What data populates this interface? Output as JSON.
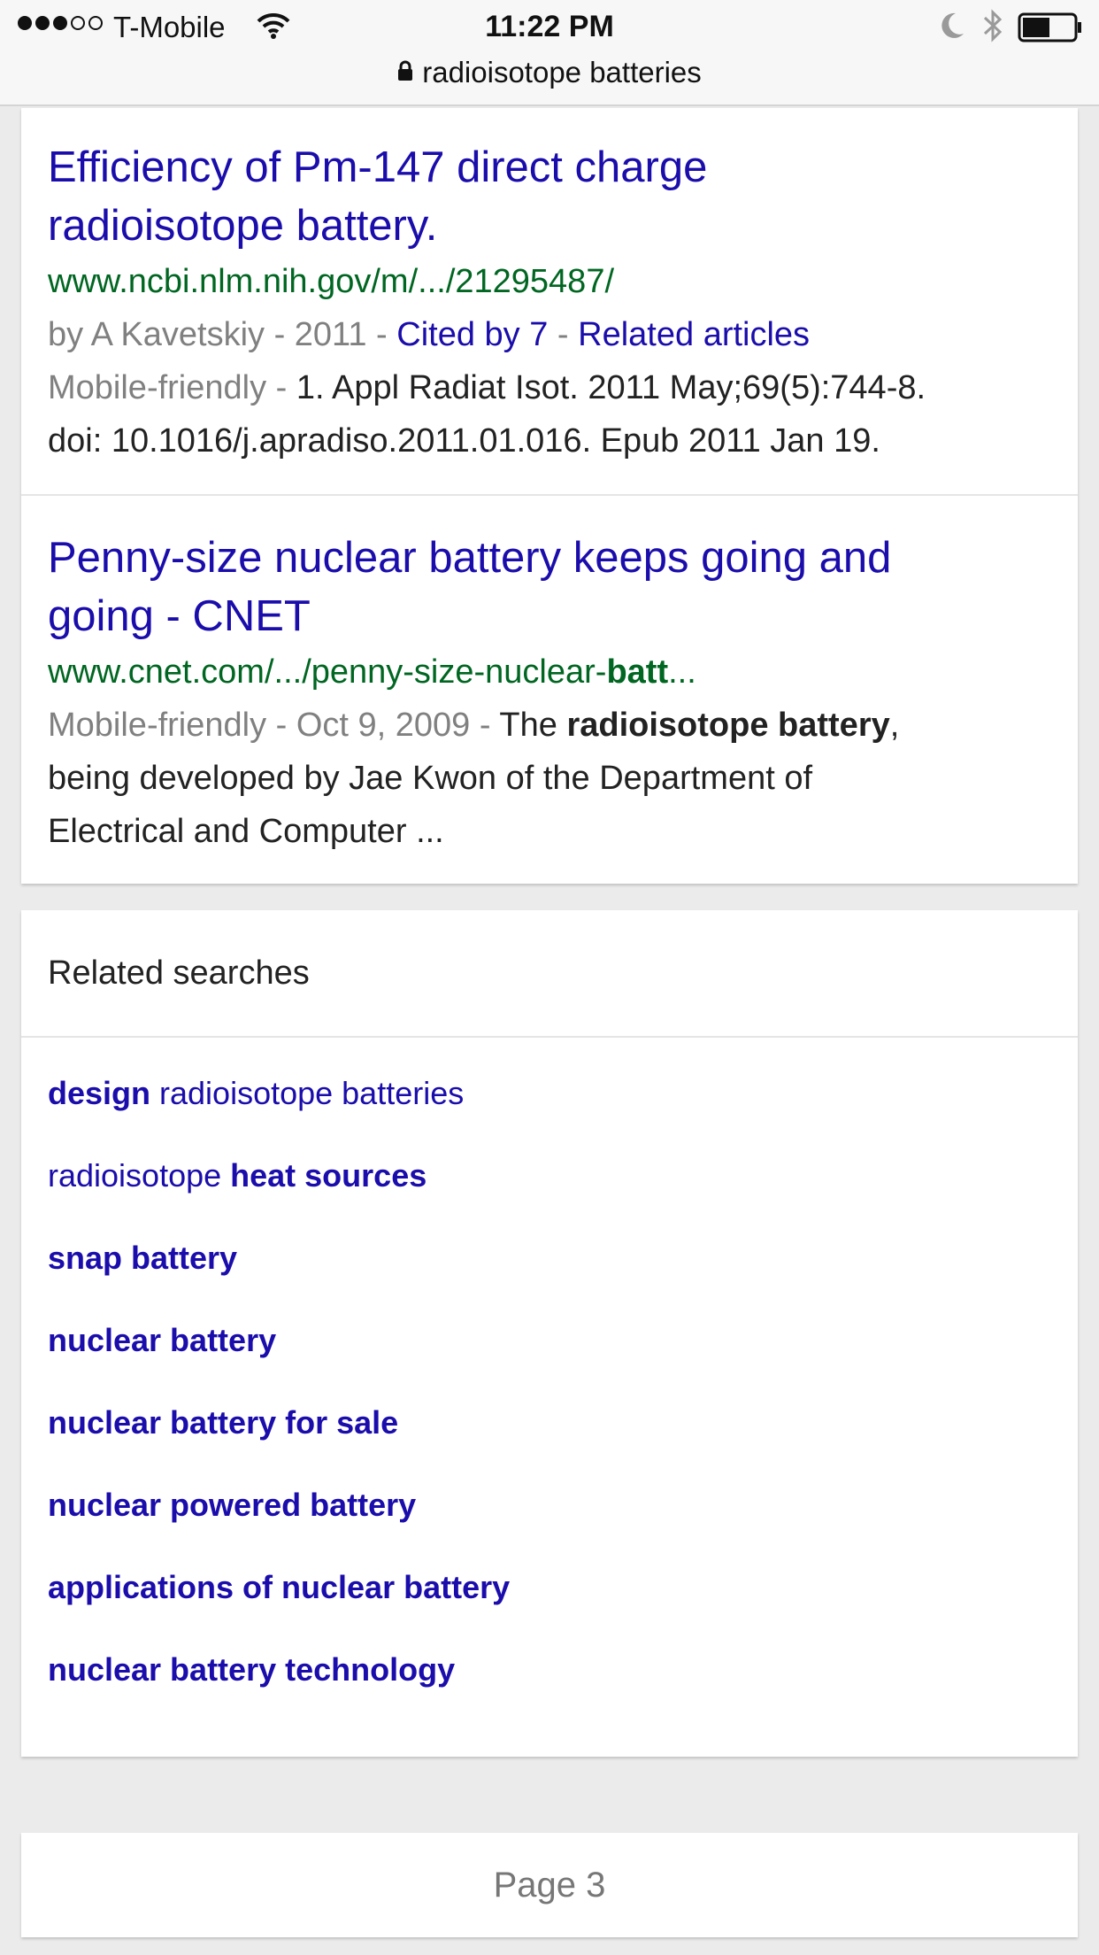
{
  "status_bar": {
    "carrier": "T-Mobile",
    "time": "11:22 PM",
    "signal_bars_filled": 3,
    "signal_bars_total": 5
  },
  "url_bar": {
    "text": "radioisotope batteries",
    "icon": "lock-icon"
  },
  "results": [
    {
      "title_line1": "Efficiency of Pm-147 direct charge",
      "title_line2": "radioisotope battery.",
      "url": "www.ncbi.nlm.nih.gov/m/.../21295487/",
      "meta_by": "by A Kavetskiy - 2011 - ",
      "cited": "Cited by 7",
      "sep": " - ",
      "related": "Related articles",
      "mobile": "Mobile-friendly - ",
      "snippet_1": "1. Appl Radiat Isot. 2011 May;69(5):744-8.",
      "snippet_2": "doi: 10.1016/j.apradiso.2011.01.016. Epub 2011 Jan 19."
    },
    {
      "title_line1": "Penny-size nuclear battery keeps going and",
      "title_line2": "going - CNET",
      "url_plain": "www.cnet.com/.../penny-size-nuclear-",
      "url_bold": "batt",
      "url_tail": "...",
      "mobile": "Mobile-friendly - Oct 9, 2009 - ",
      "snippet_pre": "The ",
      "snippet_bold": "radioisotope battery",
      "snippet_post": ",",
      "snippet_2": "being developed by Jae Kwon of the Department of",
      "snippet_3": "Electrical and Computer ..."
    }
  ],
  "related_searches": {
    "header": "Related searches",
    "items": [
      {
        "bold": "design",
        "plain": " radioisotope batteries",
        "order": "bold-first"
      },
      {
        "plain": "radioisotope ",
        "bold": "heat sources",
        "order": "plain-first"
      },
      {
        "bold": "snap battery",
        "plain": "",
        "order": "bold-first"
      },
      {
        "bold": "nuclear battery",
        "plain": "",
        "order": "bold-first"
      },
      {
        "bold": "nuclear battery for sale",
        "plain": "",
        "order": "bold-first"
      },
      {
        "bold": "nuclear powered battery",
        "plain": "",
        "order": "bold-first"
      },
      {
        "bold": "applications of nuclear battery",
        "plain": "",
        "order": "bold-first"
      },
      {
        "bold": "nuclear battery technology",
        "plain": "",
        "order": "bold-first"
      }
    ]
  },
  "pagination": {
    "label": "Page 3"
  },
  "colors": {
    "link": "#1a0dab",
    "url_green": "#006621",
    "meta_gray": "#808080",
    "page_background": "#ebebeb"
  }
}
